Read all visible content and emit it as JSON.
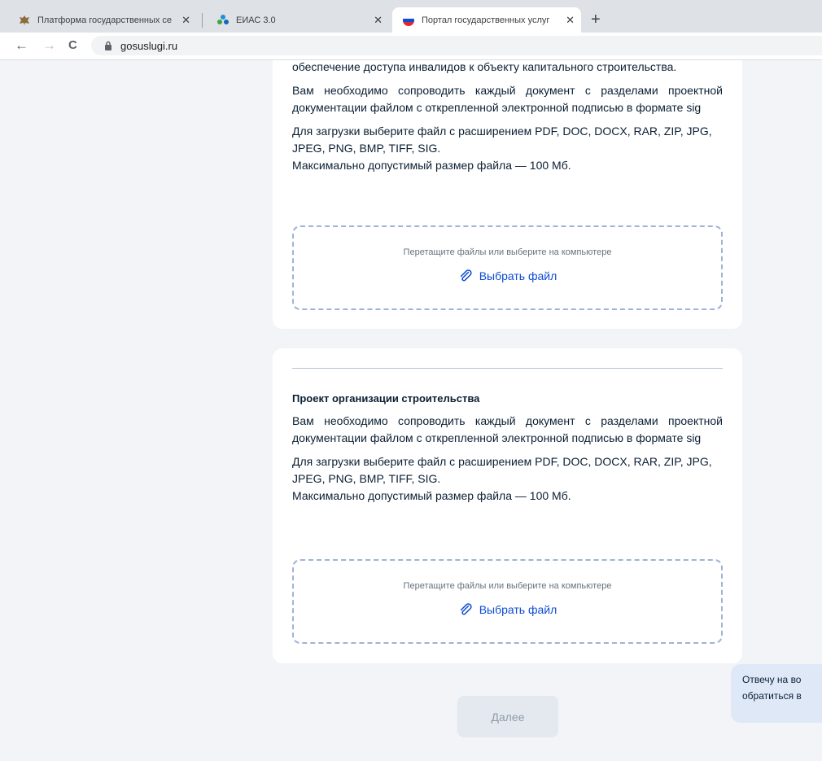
{
  "browser": {
    "tabs": [
      {
        "title": "Платформа государственных се"
      },
      {
        "title": "ЕИАС 3.0"
      },
      {
        "title": "Портал государственных услуг"
      }
    ],
    "new_tab": "+",
    "back": "←",
    "forward": "→",
    "reload": "C",
    "url": "gosuslugi.ru"
  },
  "card1": {
    "cut_line": "обеспечение доступа инвалидов к объекту капитального строительства.",
    "signature_note": "Вам необходимо сопроводить каждый документ с разделами проектной документации файлом с открепленной электронной подписью в формате sig",
    "formats_note": "Для загрузки выберите файл с расширением PDF, DOC, DOCX, RAR, ZIP, JPG, JPEG, PNG, BMP, TIFF, SIG.",
    "size_note": "Максимально допустимый размер файла — 100 Мб.",
    "dropzone": {
      "hint": "Перетащите файлы или выберите на компьютере",
      "button": "Выбрать файл"
    }
  },
  "card2": {
    "title": "Проект организации строительства",
    "signature_note": "Вам необходимо сопроводить каждый документ с разделами проектной документации файлом с открепленной электронной подписью в формате sig",
    "formats_note": "Для загрузки выберите файл с расширением PDF, DOC, DOCX, RAR, ZIP, JPG, JPEG, PNG, BMP, TIFF, SIG.",
    "size_note": "Максимально допустимый размер файла — 100 Мб.",
    "dropzone": {
      "hint": "Перетащите файлы или выберите на компьютере",
      "button": "Выбрать файл"
    }
  },
  "next_button": "Далее",
  "chat": {
    "line1": "Отвечу на во",
    "line2": "обратиться в"
  },
  "colors": {
    "accent": "#0d4cd3",
    "dropzone_border": "#9eb3d6",
    "page_bg": "#f2f4f8"
  }
}
